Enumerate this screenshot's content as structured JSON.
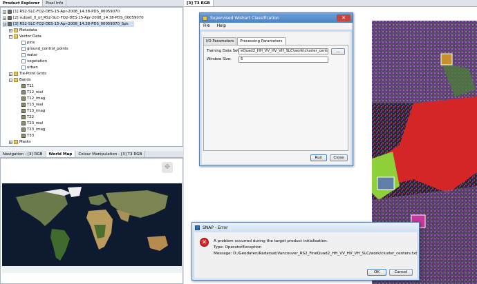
{
  "left_tabs": [
    "Product Explorer",
    "Pixel Info"
  ],
  "tree": {
    "products": [
      "[1] RS2-SLC-FQ2-DES-15-Apr-2008_14.38-PDS_00059070",
      "[2] subset_0_of_RS2-SLC-FQ2-DES-15-Apr-2008_14.38-PDS_00059070",
      "[3] RS2-SLC-FQ2-DES-15-Apr-2008_14.38-PDS_00059070_Spk"
    ],
    "metadata": "Metadata",
    "vector_data": "Vector Data",
    "vectors": [
      "pins",
      "ground_control_points",
      "water",
      "vegetation",
      "urban"
    ],
    "tie_point_grids": "Tie-Point Grids",
    "bands_folder": "Bands",
    "bands": [
      "T11",
      "T12_real",
      "T12_imag",
      "T13_real",
      "T13_imag",
      "T22",
      "T23_real",
      "T23_imag",
      "T33"
    ],
    "masks": "Masks"
  },
  "bottom_tabs": [
    "Navigation - [3] RGB",
    "World Map",
    "Colour Manipulation - [3] T3 RGB"
  ],
  "image_tab": "[3] T3 RGB",
  "class_dialog": {
    "title": "Supervised Wishart Classification",
    "menu": [
      "File",
      "Help"
    ],
    "tabs": [
      "I/O Parameters",
      "Processing Parameters"
    ],
    "training_label": "Training Data Set:",
    "training_value": "eQuad2_HH_VV_HV_VH_SLC\\work\\cluster_centers.txt",
    "browse_label": "...",
    "window_label": "Window Size:",
    "window_value": "5",
    "run_label": "Run",
    "close_label": "Close"
  },
  "error_dialog": {
    "title": "SNAP - Error",
    "line1": "A problem occurred during the target product initialisation.",
    "line2": "Type: OperatorException",
    "line3": "Message: D:/Geodaten/Radarsat/Vancouver_RS2_FineQuad2_HH_VV_HV_VH_SLC/work/cluster_centers.txt",
    "ok_label": "OK",
    "cancel_label": "Cancel"
  },
  "colors": {
    "title_bar": "#4c82c4",
    "error_red": "#d6262b",
    "classification_red": "#d42626",
    "vegetation_green": "#8fcf3a",
    "urban_purple": "#7a2f8c"
  }
}
